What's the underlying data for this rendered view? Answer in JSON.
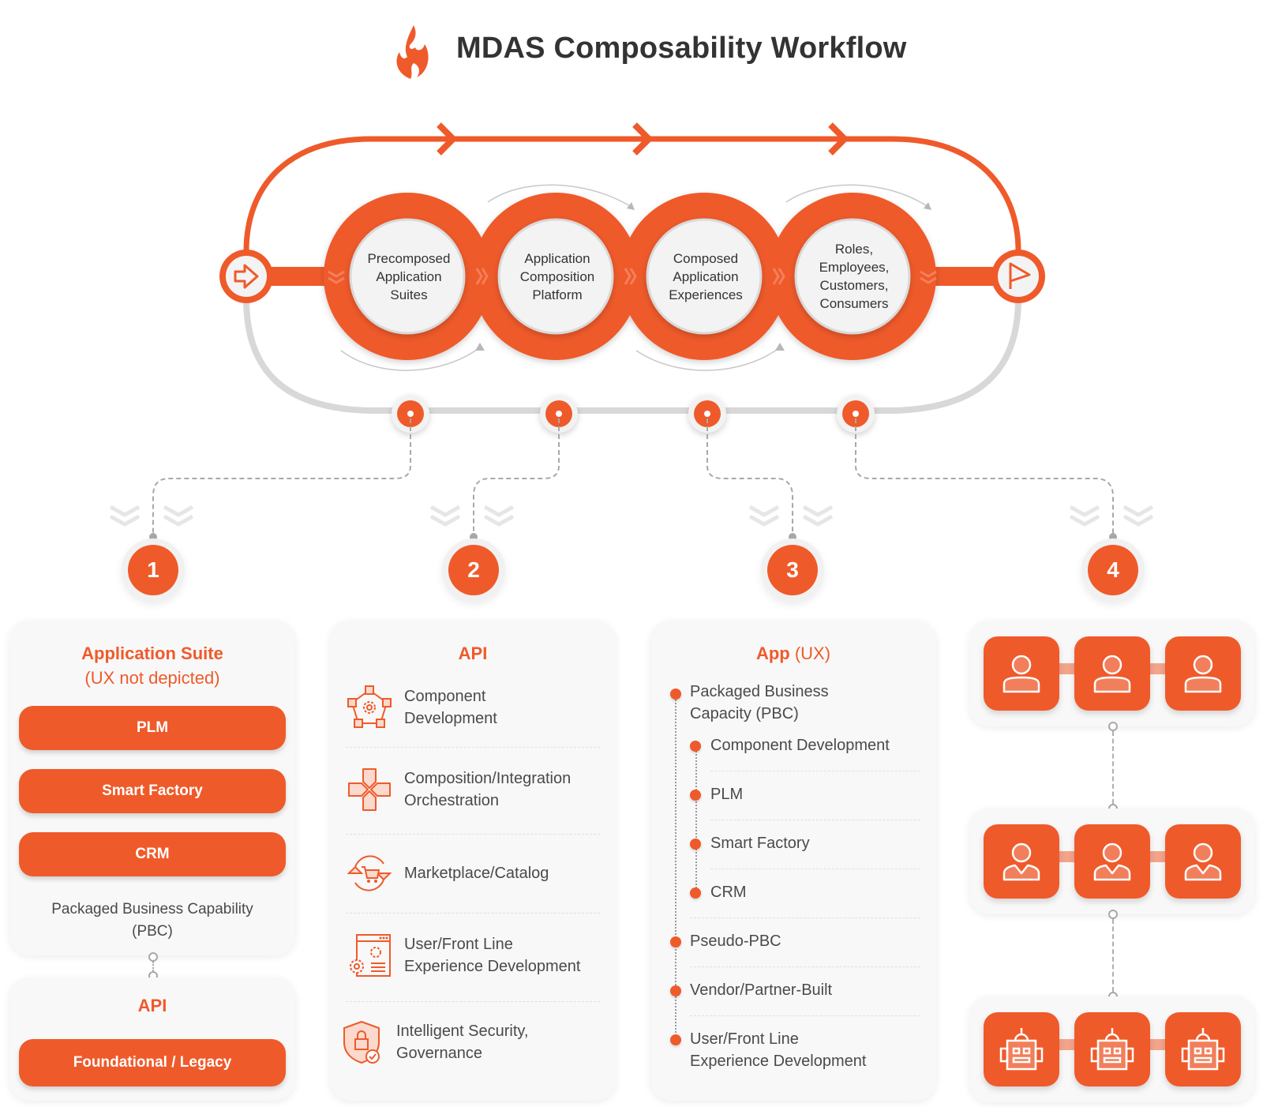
{
  "header": {
    "title": "MDAS Composability Workflow",
    "logo_icon": "flame-icon"
  },
  "colors": {
    "accent": "#ef5a2a",
    "accent_light": "#f3a48b",
    "card_bg": "#f8f8f8",
    "text": "#3d3d3d",
    "track_gray": "#d8d8d8"
  },
  "flow": {
    "start_icon": "arrow-right-icon",
    "end_icon": "flag-icon",
    "stages": [
      {
        "lines": [
          "Precomposed",
          "Application",
          "Suites"
        ]
      },
      {
        "lines": [
          "Application",
          "Composition",
          "Platform"
        ]
      },
      {
        "lines": [
          "Composed",
          "Application",
          "Experiences"
        ]
      },
      {
        "lines": [
          "Roles,",
          "Employees,",
          "Customers,",
          "Consumers"
        ]
      }
    ],
    "steps": [
      "1",
      "2",
      "3",
      "4"
    ]
  },
  "column1": {
    "title_bold": "Application Suite",
    "title_sub": "(UX not depicted)",
    "pills": [
      "PLM",
      "Smart Factory",
      "CRM"
    ],
    "caption_lines": [
      "Packaged Business Capability",
      "(PBC)"
    ],
    "api_title": "API",
    "api_pill": "Foundational / Legacy"
  },
  "column2": {
    "title": "API",
    "items": [
      {
        "icon": "component-gear-icon",
        "lines": [
          "Component",
          "Development"
        ]
      },
      {
        "icon": "orchestration-cross-icon",
        "lines": [
          "Composition/Integration",
          "Orchestration"
        ]
      },
      {
        "icon": "cart-cycle-icon",
        "lines": [
          "Marketplace/Catalog"
        ]
      },
      {
        "icon": "browser-gear-icon",
        "lines": [
          "User/Front Line",
          "Experience Development"
        ]
      },
      {
        "icon": "shield-lock-icon",
        "lines": [
          "Intelligent Security,",
          "Governance"
        ]
      }
    ]
  },
  "column3": {
    "title_bold": "App",
    "title_sub": "(UX)",
    "items": [
      {
        "level": 0,
        "lines": [
          "Packaged Business",
          "Capacity (PBC)"
        ]
      },
      {
        "level": 1,
        "lines": [
          "Component Development"
        ]
      },
      {
        "level": 1,
        "lines": [
          "PLM"
        ]
      },
      {
        "level": 1,
        "lines": [
          "Smart Factory"
        ]
      },
      {
        "level": 1,
        "lines": [
          "CRM"
        ]
      },
      {
        "level": 0,
        "lines": [
          "Pseudo-PBC"
        ]
      },
      {
        "level": 0,
        "lines": [
          "Vendor/Partner-Built"
        ]
      },
      {
        "level": 0,
        "lines": [
          "User/Front Line",
          "Experience Development"
        ]
      }
    ]
  },
  "column4": {
    "rows": [
      {
        "icon": "person-icon",
        "count": 3
      },
      {
        "icon": "employee-icon",
        "count": 3
      },
      {
        "icon": "robot-icon",
        "count": 3
      }
    ]
  }
}
